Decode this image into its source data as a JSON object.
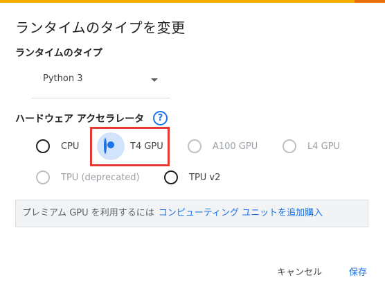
{
  "dialog": {
    "title": "ランタイムのタイプを変更"
  },
  "runtime": {
    "label": "ランタイムのタイプ",
    "selected": "Python 3"
  },
  "accelerator": {
    "label": "ハードウェア アクセラレータ",
    "help_icon": "question-mark-icon",
    "options": [
      {
        "label": "CPU",
        "checked": false,
        "disabled": false
      },
      {
        "label": "T4 GPU",
        "checked": true,
        "disabled": false
      },
      {
        "label": "A100 GPU",
        "checked": false,
        "disabled": true
      },
      {
        "label": "L4 GPU",
        "checked": false,
        "disabled": true
      },
      {
        "label": "TPU (deprecated)",
        "checked": false,
        "disabled": true
      },
      {
        "label": "TPU v2",
        "checked": false,
        "disabled": false
      }
    ]
  },
  "info": {
    "text": "プレミアム GPU を利用するには",
    "link": "コンピューティング ユニットを追加購入"
  },
  "footer": {
    "cancel_label": "キャンセル",
    "save_label": "保存"
  },
  "colors": {
    "accent": "#1a73e8",
    "top_bar": "#f9ab00",
    "highlight": "#e53935"
  }
}
